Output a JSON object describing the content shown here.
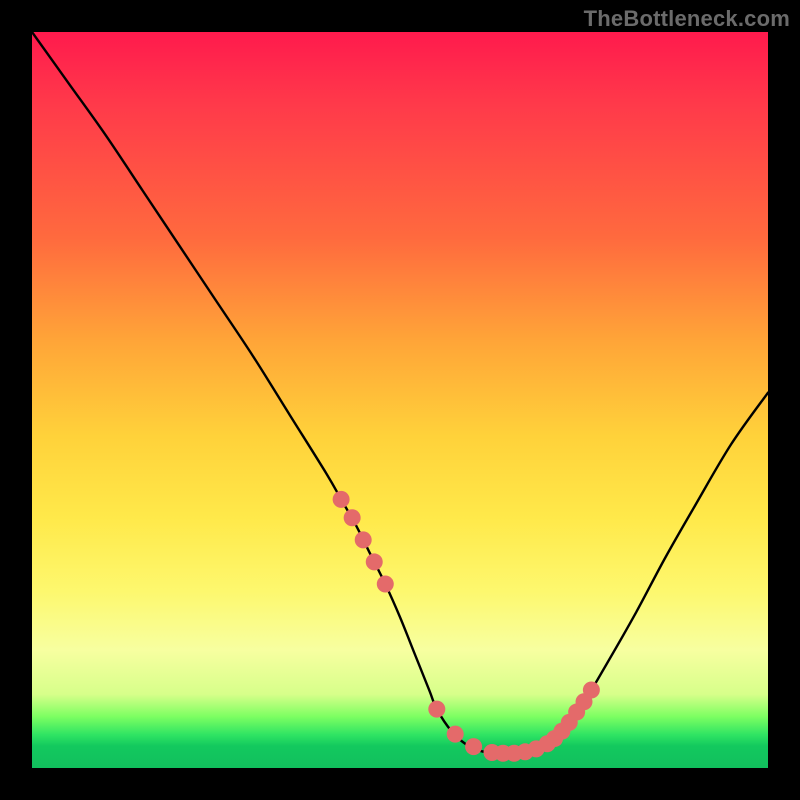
{
  "watermark": "TheBottleneck.com",
  "colors": {
    "background": "#000000",
    "curve": "#000000",
    "marker_fill": "#e46a6a",
    "marker_stroke": "#cc5252",
    "gradient_top": "#ff1a4d",
    "gradient_mid": "#ffd23a",
    "gradient_bottom": "#11bf5d"
  },
  "chart_data": {
    "type": "line",
    "title": "",
    "xlabel": "",
    "ylabel": "",
    "xlim": [
      0,
      100
    ],
    "ylim": [
      0,
      100
    ],
    "grid": false,
    "legend": false,
    "series": [
      {
        "name": "bottleneck-curve",
        "x": [
          0,
          5,
          10,
          15,
          20,
          25,
          30,
          35,
          40,
          42,
          44,
          46,
          48,
          50,
          52,
          54,
          55,
          57,
          59,
          61,
          63,
          65,
          67,
          69,
          70,
          72,
          75,
          78,
          82,
          86,
          90,
          95,
          100
        ],
        "y": [
          100,
          93,
          86,
          78.5,
          71,
          63.5,
          56,
          48,
          40,
          36.5,
          33,
          29,
          25,
          20.5,
          15.5,
          10.5,
          8,
          5,
          3.2,
          2.3,
          2,
          2,
          2.2,
          2.8,
          3.3,
          5,
          9,
          14,
          21,
          28.5,
          35.5,
          44,
          51
        ]
      }
    ],
    "markers": {
      "name": "highlighted-points",
      "x": [
        42,
        43.5,
        45,
        46.5,
        48,
        55,
        57.5,
        60,
        62.5,
        64,
        65.5,
        67,
        68.5,
        70,
        71,
        72,
        73,
        74,
        75,
        76
      ],
      "y": [
        36.5,
        34,
        31,
        28,
        25,
        8,
        4.6,
        2.9,
        2.1,
        2,
        2,
        2.2,
        2.6,
        3.3,
        4,
        5,
        6.2,
        7.6,
        9,
        10.6
      ]
    }
  }
}
